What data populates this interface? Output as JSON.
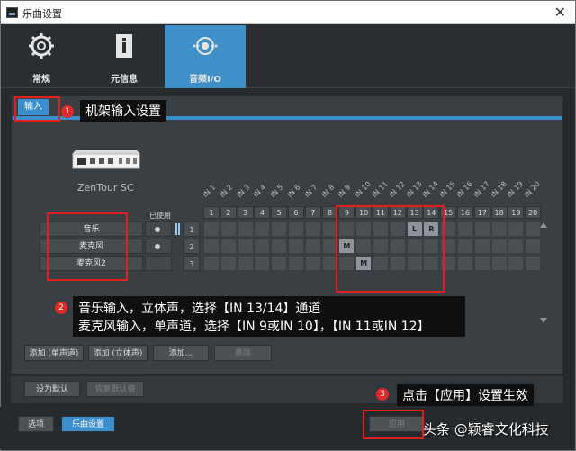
{
  "window": {
    "title": "乐曲设置"
  },
  "tabs": [
    {
      "label": "常规",
      "icon": "gear-icon"
    },
    {
      "label": "元信息",
      "icon": "document-info-icon"
    },
    {
      "label": "音频I/O",
      "icon": "audio-io-icon",
      "active": true
    }
  ],
  "subtab": {
    "label": "输入"
  },
  "device": {
    "name": "ZenTour SC"
  },
  "grid": {
    "used_header": "已使用",
    "columns": [
      "IN 1",
      "IN 2",
      "IN 3",
      "IN 4",
      "IN 5",
      "IN 6",
      "IN 7",
      "IN 8",
      "IN 9",
      "IN 10",
      "IN 11",
      "IN 12",
      "IN 13",
      "IN 14",
      "IN 15",
      "IN 16",
      "IN 17",
      "IN 18",
      "IN 19",
      "IN 20"
    ],
    "column_numbers": [
      "1",
      "2",
      "3",
      "4",
      "5",
      "6",
      "7",
      "8",
      "9",
      "10",
      "11",
      "12",
      "13",
      "14",
      "15",
      "16",
      "17",
      "18",
      "19",
      "20"
    ],
    "rows": [
      {
        "name": "音乐",
        "used": true,
        "index": "1",
        "assign": {
          "13": "L",
          "14": "R"
        }
      },
      {
        "name": "麦克风",
        "used": true,
        "index": "2",
        "assign": {
          "9": "M"
        }
      },
      {
        "name": "麦克风2",
        "used": false,
        "index": "3",
        "assign": {
          "10": "M"
        }
      }
    ]
  },
  "buttons": {
    "add_mono": "添加 (单声道)",
    "add_stereo": "添加 (立体声)",
    "add": "添加...",
    "remove": "移除",
    "set_default": "设为默认",
    "restore_default": "恢复默认值",
    "options": "选项",
    "song_settings": "乐曲设置",
    "apply": "应用"
  },
  "annotations": {
    "a1": {
      "num": "1",
      "text": "机架输入设置"
    },
    "a2": {
      "num": "2",
      "line1": "音乐输入，立体声，选择【IN 13/14】通道",
      "line2": "麦克风输入，单声道，选择【IN 9或IN 10】，【IN 11或IN 12】"
    },
    "a3": {
      "num": "3",
      "text": "点击【应用】设置生效"
    }
  },
  "watermark": "头条 @颖睿文化科技",
  "colors": {
    "accent": "#3c8fcf",
    "annotation_red": "#e02020"
  }
}
